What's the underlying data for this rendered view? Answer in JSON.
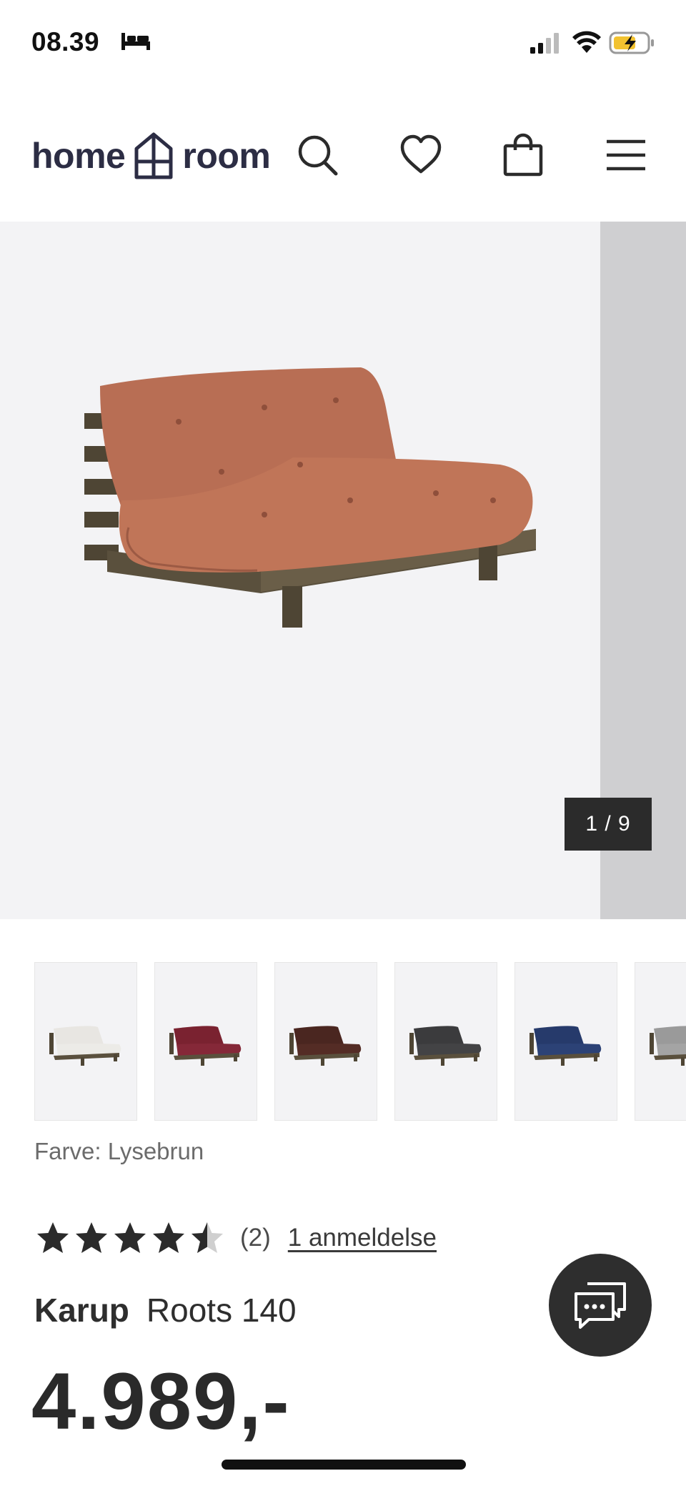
{
  "status_bar": {
    "time": "08.39",
    "icons": [
      "sleep-icon",
      "cellular-signal-icon",
      "wifi-icon",
      "battery-charging-icon"
    ]
  },
  "header": {
    "logo_left": "home",
    "logo_right": "room",
    "icons": [
      "search-icon",
      "heart-icon",
      "shopping-bag-icon",
      "menu-icon"
    ]
  },
  "gallery": {
    "counter": "1 / 9",
    "main_image": "sofa-bed-light-brown",
    "thumbnails": [
      {
        "color": "#e8e6e2",
        "name": "white"
      },
      {
        "color": "#7a2230",
        "name": "bordeaux"
      },
      {
        "color": "#4a2620",
        "name": "brown"
      },
      {
        "color": "#3b3b3d",
        "name": "dark-grey"
      },
      {
        "color": "#263a6b",
        "name": "navy"
      },
      {
        "color": "#9a9a9a",
        "name": "grey"
      }
    ]
  },
  "product": {
    "color_label": "Farve: Lysebrun",
    "rating": 4.5,
    "rating_count": "(2)",
    "reviews_link": "1 anmeldelse",
    "brand": "Karup",
    "model": "Roots 140",
    "price": "4.989,-"
  },
  "colors": {
    "logo": "#2c2d44",
    "cushion": "#b86e54",
    "frame": "#4e4534",
    "dark": "#2b2b2b"
  }
}
